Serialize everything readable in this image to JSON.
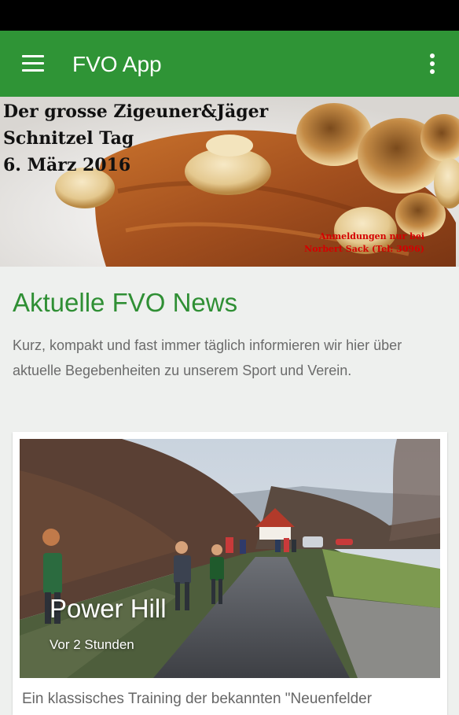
{
  "app": {
    "title": "FVO App"
  },
  "icons": {
    "menu": "hamburger-menu-icon",
    "overflow": "more-vert-icon"
  },
  "colors": {
    "primary": "#2f9436",
    "accent_text": "#2f8f34",
    "hero_note": "#d40000"
  },
  "hero": {
    "title": "Der grosse Zigeuner&Jäger\nSchnitzel Tag\n6. März 2016",
    "note": "Anmeldungen nur bei\nNorbert Sack (Tel: 3096)"
  },
  "news": {
    "heading": "Aktuelle FVO News",
    "description": "Kurz, kompakt und fast immer täglich informieren wir hier über aktuelle Begebenheiten zu unserem Sport und Verein."
  },
  "articles": [
    {
      "title": "Power Hill",
      "time": "Vor 2 Stunden",
      "excerpt": "Ein klassisches Training der bekannten \"Neuenfelder"
    }
  ]
}
